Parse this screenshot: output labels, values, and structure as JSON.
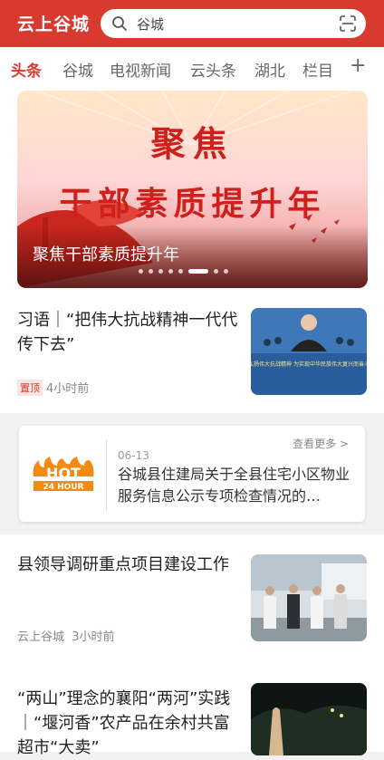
{
  "header": {
    "app_title": "云上谷城",
    "search_text": "谷城"
  },
  "tabs": [
    "头条",
    "谷城",
    "电视新闻",
    "云头条",
    "湖北",
    "栏目"
  ],
  "active_tab": "头条",
  "add_tab_symbol": "+",
  "banner": {
    "headline": "聚焦",
    "subheadline": "干部素质提升年",
    "caption": "聚焦干部素质提升年",
    "slide_count": 8,
    "active_slide": 6
  },
  "articles": [
    {
      "title": "习语｜“把伟大抗战精神一代代传下去”",
      "badge": "置顶",
      "time": "4小时前",
      "thumb_caption": "弘扬伟大抗战精神 为实现中华民族伟大复兴而奋斗"
    },
    {
      "title": "县领导调研重点项目建设工作",
      "source": "云上谷城",
      "time": "3小时前"
    },
    {
      "title": "“两山”理念的襄阳“两河”实践｜“堰河香”农产品在余村共富超市“大卖”"
    }
  ],
  "hot_card": {
    "logo_text": "24 HOUR",
    "logo_hot": "HOT",
    "more": "查看更多 >",
    "date": "06-13",
    "text": "谷城县住建局关于全县住宅小区物业服务信息公示专项检查情况的…"
  },
  "colors": {
    "brand_red": "#d93a2f",
    "hot_orange": "#f28a14"
  }
}
